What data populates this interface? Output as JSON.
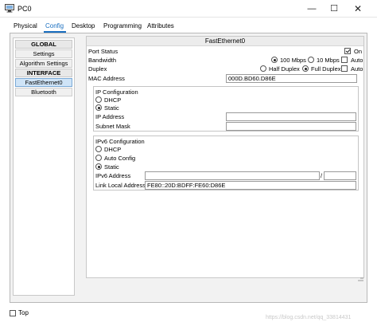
{
  "window": {
    "title": "PC0",
    "minimize": "—",
    "maximize": "☐",
    "close": "✕"
  },
  "tabs": [
    {
      "label": "Physical",
      "active": false
    },
    {
      "label": "Config",
      "active": true
    },
    {
      "label": "Desktop",
      "active": false
    },
    {
      "label": "Programming",
      "active": false
    },
    {
      "label": "Attributes",
      "active": false
    }
  ],
  "sidebar": {
    "global_header": "GLOBAL",
    "settings": "Settings",
    "algorithm_settings": "Algorithm Settings",
    "interface_header": "INTERFACE",
    "fastethernet": "FastEthernet0",
    "bluetooth": "Bluetooth"
  },
  "panel": {
    "title": "FastEthernet0",
    "port_status": {
      "label": "Port Status",
      "on_label": "On",
      "checked": true
    },
    "bandwidth": {
      "label": "Bandwidth",
      "opt100": "100 Mbps",
      "opt10": "10 Mbps",
      "auto": "Auto",
      "selected": "100 Mbps",
      "auto_checked": false
    },
    "duplex": {
      "label": "Duplex",
      "half": "Half Duplex",
      "full": "Full Duplex",
      "auto": "Auto",
      "selected": "Full Duplex",
      "auto_checked": false
    },
    "mac": {
      "label": "MAC Address",
      "value": "000D.BD60.D86E"
    },
    "ip_config": {
      "title": "IP Configuration",
      "dhcp": "DHCP",
      "static": "Static",
      "selected": "Static",
      "ip_label": "IP Address",
      "ip_value": "",
      "mask_label": "Subnet Mask",
      "mask_value": ""
    },
    "ipv6_config": {
      "title": "IPv6 Configuration",
      "dhcp": "DHCP",
      "auto": "Auto Config",
      "static": "Static",
      "selected": "Static",
      "addr_label": "IPv6 Address",
      "addr_value": "",
      "slash": "/",
      "prefix_value": "",
      "link_local_label": "Link Local Address:",
      "link_local_value": "FE80::20D:BDFF:FE60:D86E"
    }
  },
  "footer": {
    "top_label": "Top",
    "top_checked": false,
    "watermark": "https://blog.csdn.net/qq_33814431"
  },
  "colors": {
    "accent": "#1a6fc0",
    "sidebar_active": "#cfe4f7"
  }
}
